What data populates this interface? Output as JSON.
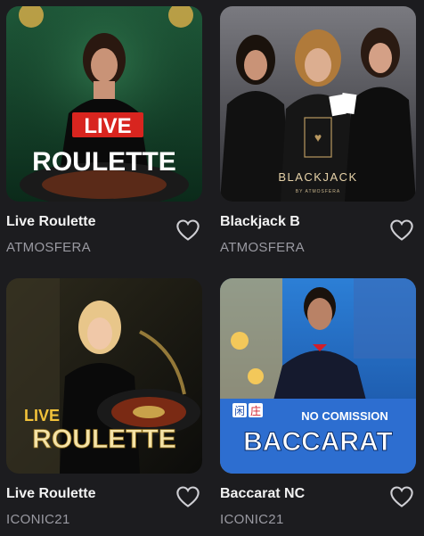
{
  "games": [
    {
      "title": "Live Roulette",
      "provider": "ATMOSFERA",
      "art": {
        "badge": "LIVE",
        "headline": "ROULETTE"
      },
      "favorite_icon": "heart-outline-icon"
    },
    {
      "title": "Blackjack B",
      "provider": "ATMOSFERA",
      "art": {
        "headline": "BLACKJACK",
        "subline": "BY ATMOSFERA"
      },
      "favorite_icon": "heart-outline-icon"
    },
    {
      "title": "Live Roulette",
      "provider": "ICONIC21",
      "art": {
        "badge": "LIVE",
        "headline": "ROULETTE"
      },
      "favorite_icon": "heart-outline-icon"
    },
    {
      "title": "Baccarat NC",
      "provider": "ICONIC21",
      "art": {
        "tag": "NO COMISSION",
        "headline": "BACCARAT",
        "chip_left": "闲",
        "chip_right": "庄"
      },
      "favorite_icon": "heart-outline-icon"
    }
  ],
  "colors": {
    "background": "#1c1c1f",
    "title": "#f2f2f2",
    "provider": "#9a9aa2",
    "live_red": "#d8251f"
  }
}
